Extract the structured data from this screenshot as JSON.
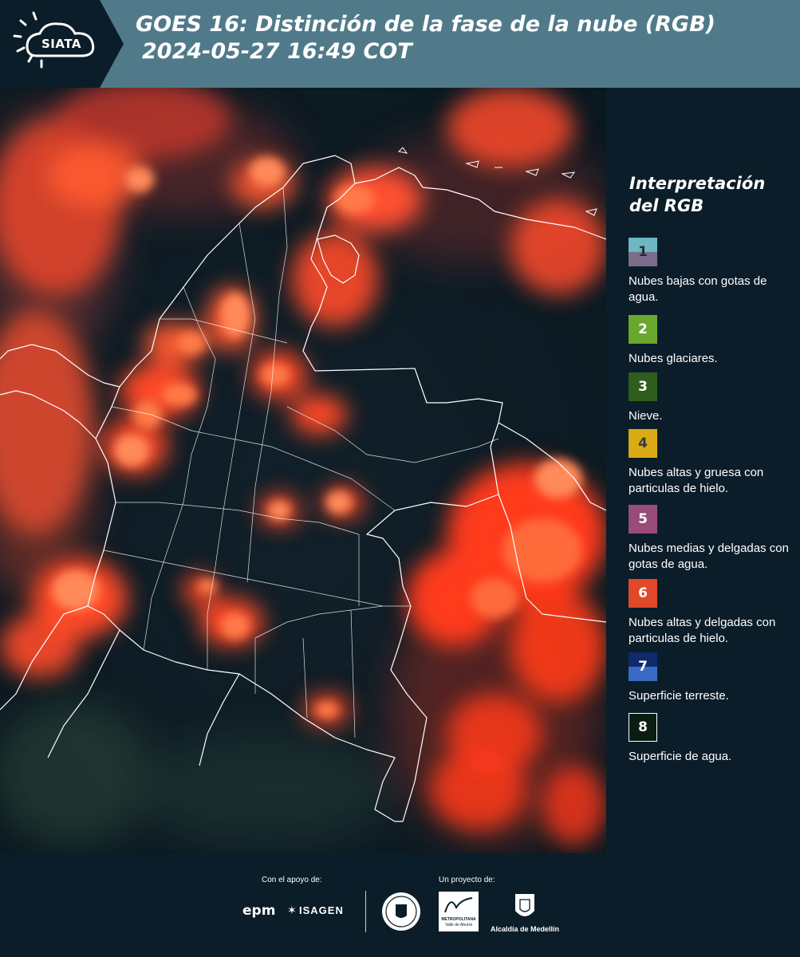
{
  "header": {
    "logo_text": "SIATA",
    "title_line1": "GOES 16: Distinción de la fase de la nube (RGB)",
    "title_line2": "2024-05-27 16:49 COT",
    "background_color": "#507a89"
  },
  "legend": {
    "title_line1": "Interpretación",
    "title_line2": "del RGB",
    "items": [
      {
        "number": "1",
        "label": "Nubes bajas con gotas de agua.",
        "colors": [
          "#6bb7c4",
          "#7a6e8a"
        ]
      },
      {
        "number": "2",
        "label": "Nubes glaciares.",
        "colors": [
          "#6aa72e"
        ]
      },
      {
        "number": "3",
        "label": "Nieve.",
        "colors": [
          "#2f5d1e"
        ]
      },
      {
        "number": "4",
        "label": "Nubes altas y gruesa con particulas de hielo.",
        "colors": [
          "#d9ab17"
        ]
      },
      {
        "number": "5",
        "label": "Nubes medias y delgadas con gotas de agua.",
        "colors": [
          "#994b7a"
        ]
      },
      {
        "number": "6",
        "label": "Nubes altas y delgadas con particulas de hielo.",
        "colors": [
          "#e0482a"
        ]
      },
      {
        "number": "7",
        "label": "Superficie terreste.",
        "colors": [
          "#0e2a6b",
          "#3a6bc4"
        ]
      },
      {
        "number": "8",
        "label": "Superficie de agua.",
        "colors": [
          "#0b1d13"
        ]
      }
    ]
  },
  "footer": {
    "support_label": "Con el apoyo de:",
    "project_label": "Un proyecto de:",
    "sponsors": [
      "epm",
      "ISAGEN"
    ],
    "area_caption_line1": "METROPOLITANA",
    "area_caption_line2": "Valle de Aburrá",
    "alcaldia_caption": "Alcaldía de Medellín"
  },
  "map": {
    "colors": {
      "background": "#0c1c24",
      "cloud_high_thin_ice": "#ff3a1a",
      "cloud_core": "#ff7a55",
      "borders": "#ffffff"
    }
  }
}
